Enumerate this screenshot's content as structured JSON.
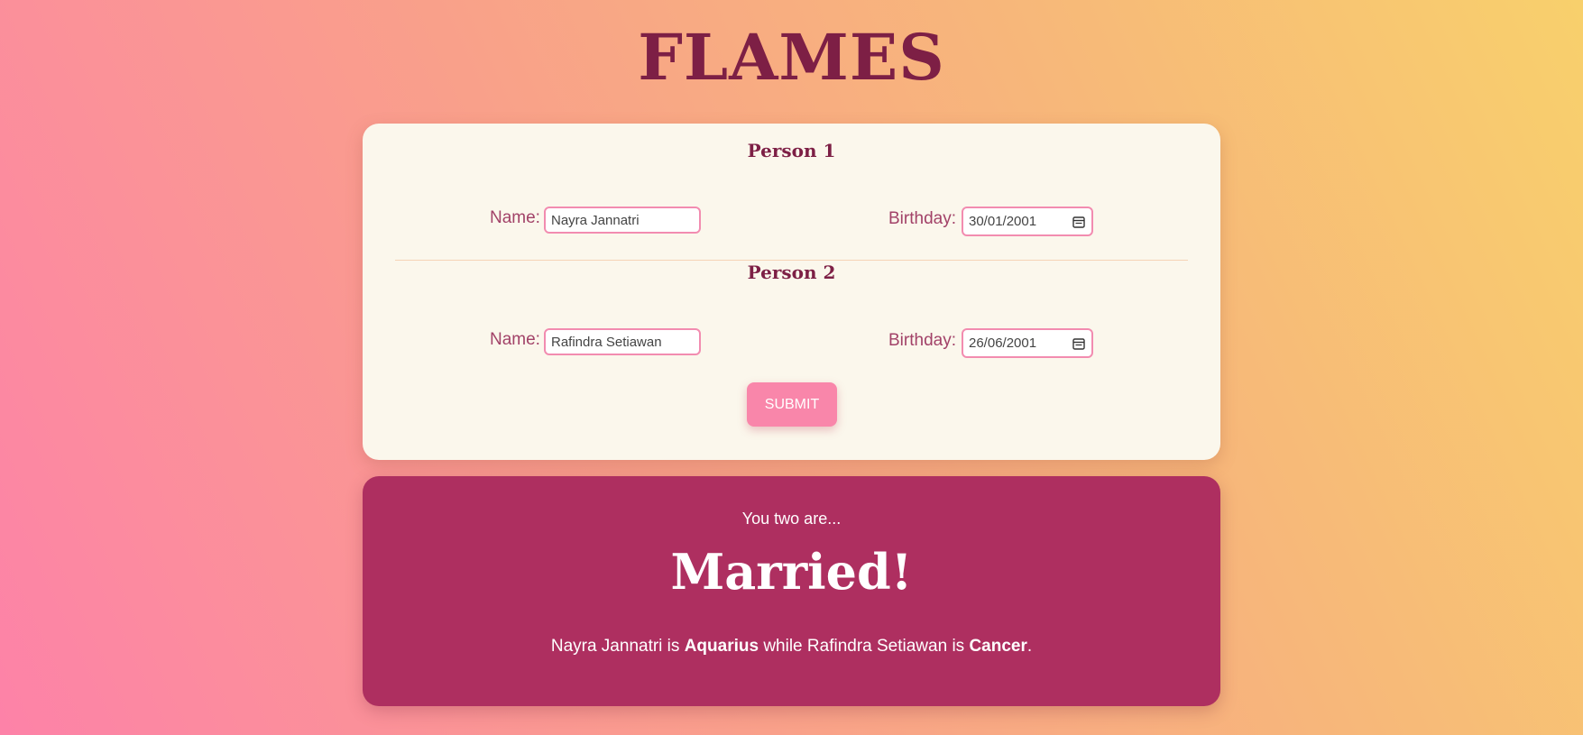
{
  "app": {
    "title": "FLAMES"
  },
  "form": {
    "person1": {
      "heading": "Person 1",
      "name_label": "Name:",
      "name_value": "Nayra Jannatri",
      "birthday_label": "Birthday:",
      "birthday_value": "30/01/2001"
    },
    "person2": {
      "heading": "Person 2",
      "name_label": "Name:",
      "name_value": "Rafindra Setiawan",
      "birthday_label": "Birthday:",
      "birthday_value": "26/06/2001"
    },
    "submit_label": "SUBMIT"
  },
  "result": {
    "intro": "You two are...",
    "verdict": "Married!",
    "summary": {
      "name1": "Nayra Jannatri",
      "is1": " is ",
      "sign1": "Aquarius",
      "while": " while ",
      "name2": "Rafindra Setiawan",
      "is2": " is ",
      "sign2": "Cancer",
      "end": "."
    }
  },
  "colors": {
    "accent": "#7d1f45",
    "card_bg": "#fbf7ec",
    "result_bg": "#ae2f60",
    "button_bg": "#f986aa",
    "input_border": "#f28cb0"
  },
  "icons": {
    "date_picker": "calendar-icon"
  }
}
